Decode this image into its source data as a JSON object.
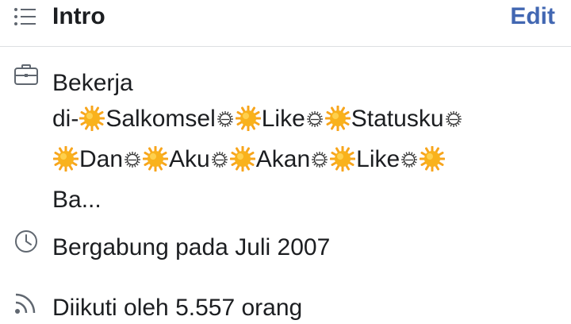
{
  "header": {
    "title": "Intro",
    "edit_label": "Edit",
    "icon": "list-icon"
  },
  "work": {
    "icon": "briefcase-icon",
    "lines": [
      [
        "Bekerja"
      ],
      [
        "di-",
        "☀",
        "Salkomsel",
        "◦",
        "☀",
        "Like",
        "◦",
        "☀",
        "Statusku",
        "◦"
      ],
      [
        "☀",
        "Dan",
        "◦",
        "☀",
        "Aku",
        "◦",
        "☀",
        "Akan",
        "◦",
        "☀",
        "Like",
        "◦",
        "☀"
      ],
      [
        "Ba..."
      ]
    ]
  },
  "joined": {
    "icon": "clock-icon",
    "text": "Bergabung pada Juli 2007"
  },
  "followers": {
    "icon": "rss-feed-icon",
    "text": "Diikuti oleh 5.557 orang"
  },
  "colors": {
    "link": "#4267b2",
    "text": "#1c1e21",
    "icon": "#606770",
    "divider": "#dddfe2",
    "sun": "#f9b21c"
  }
}
